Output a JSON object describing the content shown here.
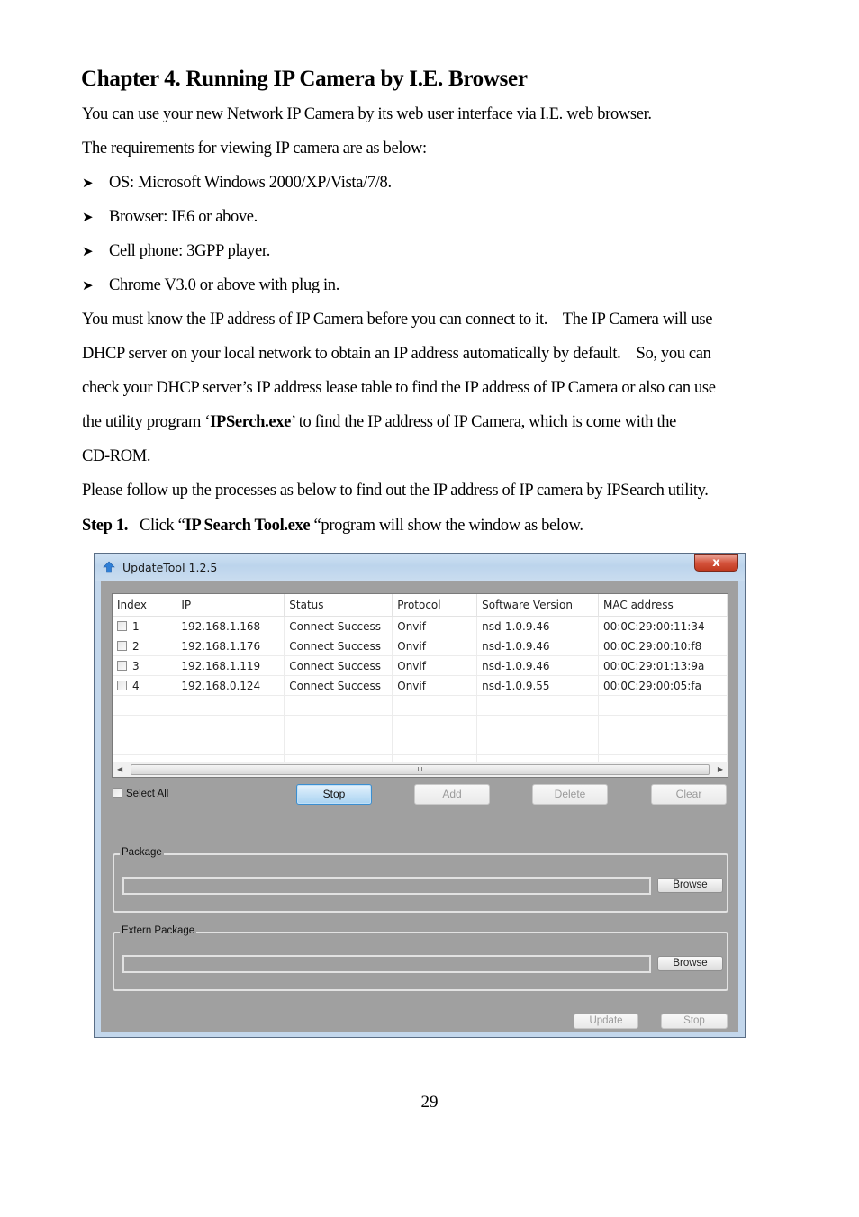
{
  "document": {
    "title": "Chapter 4. Running IP Camera by I.E. Browser",
    "intro": "You can use your new Network IP Camera by its web user interface via I.E. web browser.",
    "requirements_lead": "The requirements for viewing IP camera are as below:",
    "requirements": [
      "OS: Microsoft Windows 2000/XP/Vista/7/8.",
      "Browser: IE6 or above.",
      "Cell phone: 3GPP player.",
      "Chrome V3.0 or above with plug in."
    ],
    "para_lines": [
      "You must know the IP address of IP Camera before you can connect to it.    The IP Camera will use",
      "DHCP server on your local network to obtain an IP address automatically by default.    So, you can",
      "check your DHCP server’s IP address lease table to find the IP address of IP Camera or also can use"
    ],
    "para_line4_pre": "the utility program ‘",
    "para_line4_bold": "IPSerch.exe",
    "para_line4_post": "’ to find the IP address of IP Camera, which is come with the",
    "para_line5": "CD-ROM.",
    "follow_up": "Please follow up the processes as below to find out the IP address of IP camera by IPSearch utility.",
    "step_label": "Step 1.",
    "step_pre": "Click “",
    "step_bold": "IP Search Tool.exe",
    "step_post": " “program will show the window as below.",
    "page_number": "29"
  },
  "window": {
    "title": "UpdateTool 1.2.5",
    "close_label": "x",
    "table": {
      "columns": [
        "Index",
        "IP",
        "Status",
        "Protocol",
        "Software Version",
        "MAC address"
      ],
      "rows": [
        {
          "index": "1",
          "ip": "192.168.1.168",
          "status": "Connect Success",
          "protocol": "Onvif",
          "version": "nsd-1.0.9.46",
          "mac": "00:0C:29:00:11:34",
          "checked": false
        },
        {
          "index": "2",
          "ip": "192.168.1.176",
          "status": "Connect Success",
          "protocol": "Onvif",
          "version": "nsd-1.0.9.46",
          "mac": "00:0C:29:00:10:f8",
          "checked": false
        },
        {
          "index": "3",
          "ip": "192.168.1.119",
          "status": "Connect Success",
          "protocol": "Onvif",
          "version": "nsd-1.0.9.46",
          "mac": "00:0C:29:01:13:9a",
          "checked": false
        },
        {
          "index": "4",
          "ip": "192.168.0.124",
          "status": "Connect Success",
          "protocol": "Onvif",
          "version": "nsd-1.0.9.55",
          "mac": "00:0C:29:00:05:fa",
          "checked": false
        }
      ],
      "scroll_thumb_label": "III"
    },
    "select_all_label": "Select All",
    "buttons": {
      "stop": "Stop",
      "add": "Add",
      "delete": "Delete",
      "clear": "Clear",
      "update": "Update",
      "stop_bottom": "Stop",
      "browse": "Browse",
      "browse_extern": "Browse"
    },
    "package_label": "Package",
    "package_value": "",
    "extern_package_label": "Extern Package",
    "extern_package_value": ""
  },
  "colors": {
    "window_bg": "#a0a0a0",
    "titlebar": "#c3d7ec",
    "close_button": "#c9432a",
    "active_button": "#c6e2f7"
  }
}
